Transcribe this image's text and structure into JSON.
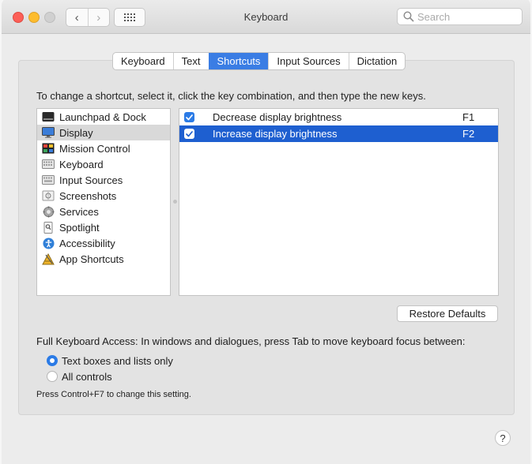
{
  "window": {
    "title": "Keyboard"
  },
  "toolbar": {
    "back_glyph": "‹",
    "forward_glyph": "›",
    "search_placeholder": "Search"
  },
  "tabs": [
    {
      "label": "Keyboard",
      "active": false
    },
    {
      "label": "Text",
      "active": false
    },
    {
      "label": "Shortcuts",
      "active": true
    },
    {
      "label": "Input Sources",
      "active": false
    },
    {
      "label": "Dictation",
      "active": false
    }
  ],
  "instructions": "To change a shortcut, select it, click the key combination, and then type the new keys.",
  "categories": [
    {
      "label": "Launchpad & Dock",
      "icon": "launchpad-icon",
      "selected": false
    },
    {
      "label": "Display",
      "icon": "display-icon",
      "selected": true
    },
    {
      "label": "Mission Control",
      "icon": "mission-control-icon",
      "selected": false
    },
    {
      "label": "Keyboard",
      "icon": "keyboard-icon",
      "selected": false
    },
    {
      "label": "Input Sources",
      "icon": "input-sources-icon",
      "selected": false
    },
    {
      "label": "Screenshots",
      "icon": "screenshots-icon",
      "selected": false
    },
    {
      "label": "Services",
      "icon": "services-icon",
      "selected": false
    },
    {
      "label": "Spotlight",
      "icon": "spotlight-icon",
      "selected": false
    },
    {
      "label": "Accessibility",
      "icon": "accessibility-icon",
      "selected": false
    },
    {
      "label": "App Shortcuts",
      "icon": "app-shortcuts-icon",
      "selected": false
    }
  ],
  "shortcuts": [
    {
      "label": "Decrease display brightness",
      "key": "F1",
      "checked": true,
      "selected": false
    },
    {
      "label": "Increase display brightness",
      "key": "F2",
      "checked": true,
      "selected": true
    }
  ],
  "restore_defaults": "Restore Defaults",
  "full_keyboard_access": {
    "label": "Full Keyboard Access: In windows and dialogues, press Tab to move keyboard focus between:",
    "options": [
      {
        "label": "Text boxes and lists only",
        "selected": true
      },
      {
        "label": "All controls",
        "selected": false
      }
    ],
    "hint": "Press Control+F7 to change this setting."
  },
  "help": {
    "glyph": "?"
  },
  "colors": {
    "accent": "#3a7de4",
    "selection": "#1e5fd0",
    "panel": "#e3e3e3",
    "window": "#ececec"
  }
}
